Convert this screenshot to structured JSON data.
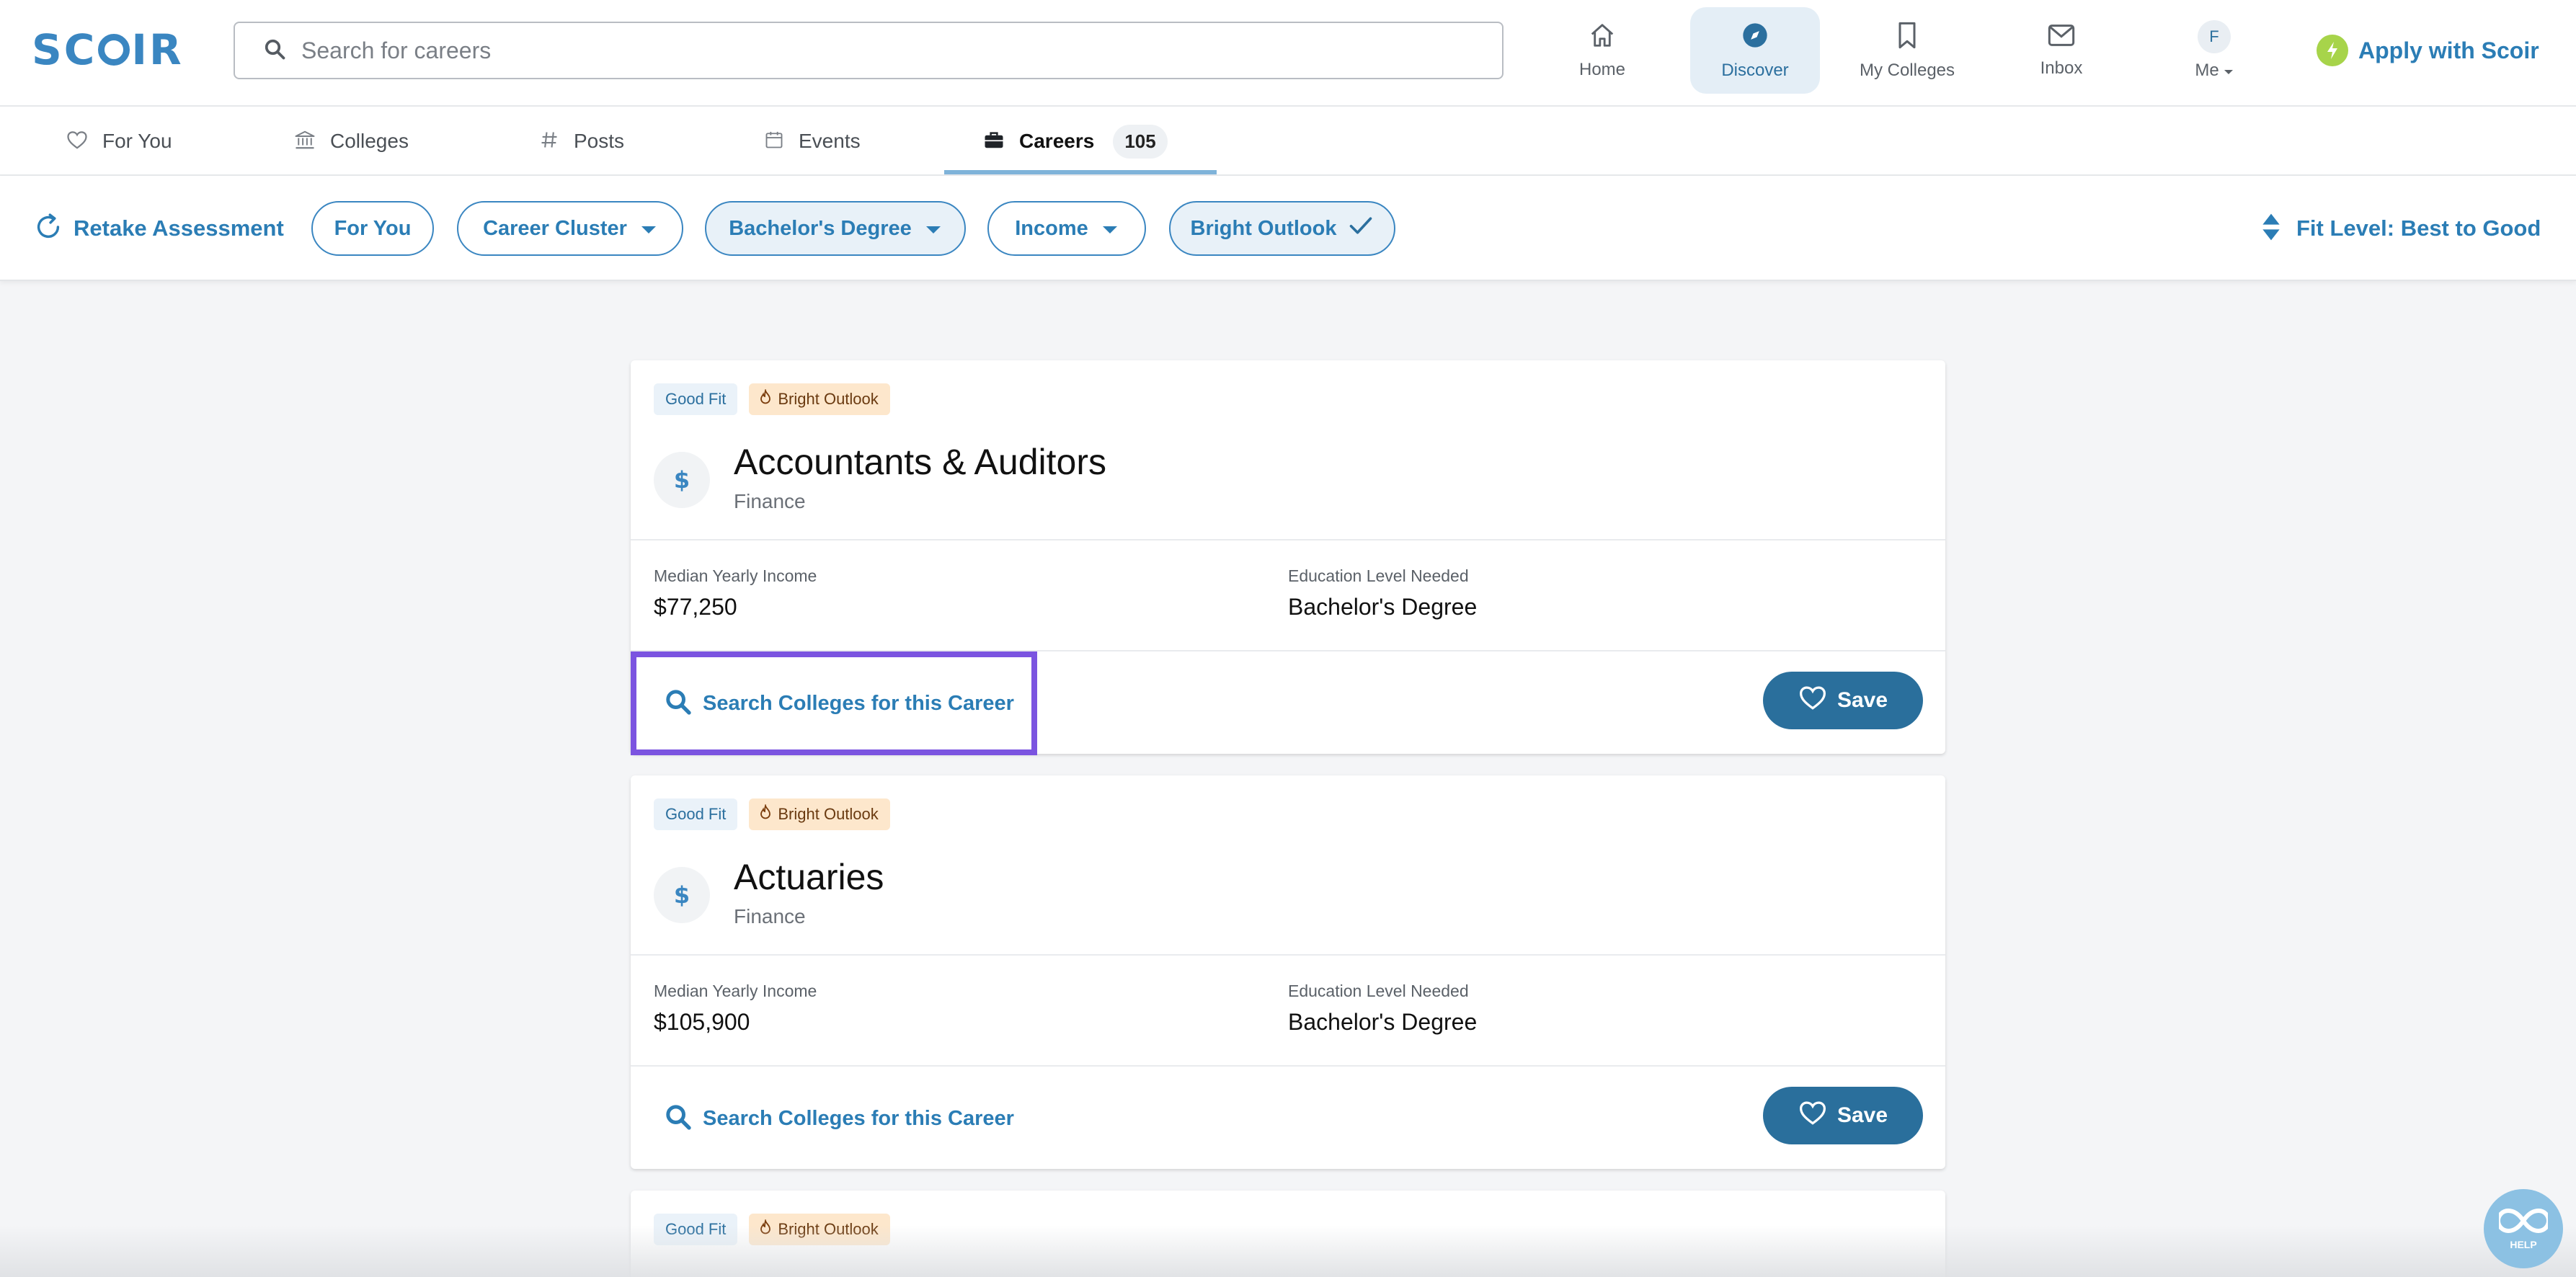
{
  "brand": {
    "logo_text": "SCOIR"
  },
  "search": {
    "placeholder": "Search for careers"
  },
  "nav": {
    "items": [
      {
        "label": "Home",
        "icon": "home-icon"
      },
      {
        "label": "Discover",
        "icon": "compass-icon",
        "active": true
      },
      {
        "label": "My Colleges",
        "icon": "bookmark-icon"
      },
      {
        "label": "Inbox",
        "icon": "envelope-icon"
      },
      {
        "label": "Me",
        "icon": "avatar",
        "initial": "F"
      }
    ],
    "apply_label": "Apply with Scoir"
  },
  "tabs": [
    {
      "label": "For You",
      "icon": "heart-outline-icon"
    },
    {
      "label": "Colleges",
      "icon": "institution-icon"
    },
    {
      "label": "Posts",
      "icon": "hash-icon"
    },
    {
      "label": "Events",
      "icon": "calendar-icon"
    },
    {
      "label": "Careers",
      "icon": "briefcase-icon",
      "count": "105",
      "active": true
    }
  ],
  "filters": {
    "retake_label": "Retake Assessment",
    "chips": [
      {
        "label": "For You"
      },
      {
        "label": "Career Cluster",
        "dropdown": true
      },
      {
        "label": "Bachelor's Degree",
        "dropdown": true,
        "selected": true
      },
      {
        "label": "Income",
        "dropdown": true
      },
      {
        "label": "Bright Outlook",
        "checked": true,
        "selected": true
      }
    ],
    "sort_label": "Fit Level: Best to Good"
  },
  "careers": [
    {
      "fit": "Good Fit",
      "outlook": "Bright Outlook",
      "icon": "$",
      "title": "Accountants & Auditors",
      "cluster": "Finance",
      "income_label": "Median Yearly Income",
      "income": "$77,250",
      "education_label": "Education Level Needed",
      "education": "Bachelor's Degree",
      "search_label": "Search Colleges for this Career",
      "save_label": "Save"
    },
    {
      "fit": "Good Fit",
      "outlook": "Bright Outlook",
      "icon": "$",
      "title": "Actuaries",
      "cluster": "Finance",
      "income_label": "Median Yearly Income",
      "income": "$105,900",
      "education_label": "Education Level Needed",
      "education": "Bachelor's Degree",
      "search_label": "Search Colleges for this Career",
      "save_label": "Save"
    },
    {
      "fit": "Good Fit",
      "outlook": "Bright Outlook"
    }
  ],
  "help": {
    "label": "HELP"
  },
  "colors": {
    "accent": "#2b7db5",
    "save_button": "#2a6f9c",
    "focus_outline": "#7b54e0",
    "bright_tag": "#fde7cc",
    "fit_tag": "#eaf2f9"
  }
}
